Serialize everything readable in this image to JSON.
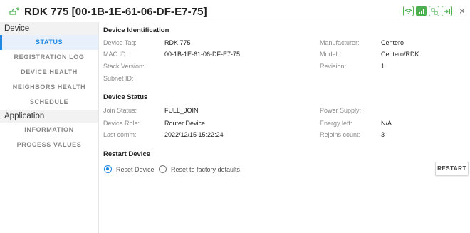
{
  "window": {
    "title": "RDK 775  [00-1B-1E-61-06-DF-E7-75]",
    "device_icon": "device-signal-icon",
    "status_icons": [
      "wifi-ok-icon",
      "signal-bars-icon",
      "network-icon",
      "power-input-icon"
    ],
    "close_label": "×",
    "accent_color": "#4caf50"
  },
  "sidebar": {
    "sections": [
      {
        "title": "Device",
        "items": [
          {
            "label": "STATUS",
            "active": true
          },
          {
            "label": "REGISTRATION LOG"
          },
          {
            "label": "DEVICE HEALTH"
          },
          {
            "label": "NEIGHBORS HEALTH"
          },
          {
            "label": "SCHEDULE"
          }
        ]
      },
      {
        "title": "Application",
        "items": [
          {
            "label": "INFORMATION"
          },
          {
            "label": "PROCESS VALUES"
          }
        ]
      }
    ],
    "active_color": "#1e88e5"
  },
  "identification": {
    "title": "Device Identification",
    "device_tag": {
      "label": "Device Tag:",
      "value": "RDK 775"
    },
    "mac_id": {
      "label": "MAC ID:",
      "value": "00-1B-1E-61-06-DF-E7-75"
    },
    "stack_version": {
      "label": "Stack Version:",
      "value": ""
    },
    "subnet_id": {
      "label": "Subnet ID:",
      "value": ""
    },
    "manufacturer": {
      "label": "Manufacturer:",
      "value": "Centero"
    },
    "model": {
      "label": "Model:",
      "value": "Centero/RDK"
    },
    "revision": {
      "label": "Revision:",
      "value": "1"
    }
  },
  "status": {
    "title": "Device Status",
    "join_status": {
      "label": "Join Status:",
      "value": "FULL_JOIN"
    },
    "device_role": {
      "label": "Device Role:",
      "value": "Router Device"
    },
    "last_comm": {
      "label": "Last comm:",
      "value": "2022/12/15 15:22:24"
    },
    "power_supply": {
      "label": "Power Supply:",
      "value": ""
    },
    "energy_left": {
      "label": "Energy left:",
      "value": "N/A"
    },
    "rejoins_count": {
      "label": "Rejoins count:",
      "value": "3"
    }
  },
  "restart": {
    "title": "Restart Device",
    "options": [
      {
        "label": "Reset Device",
        "checked": true
      },
      {
        "label": "Reset to factory defaults",
        "checked": false
      }
    ],
    "button_label": "RESTART"
  }
}
